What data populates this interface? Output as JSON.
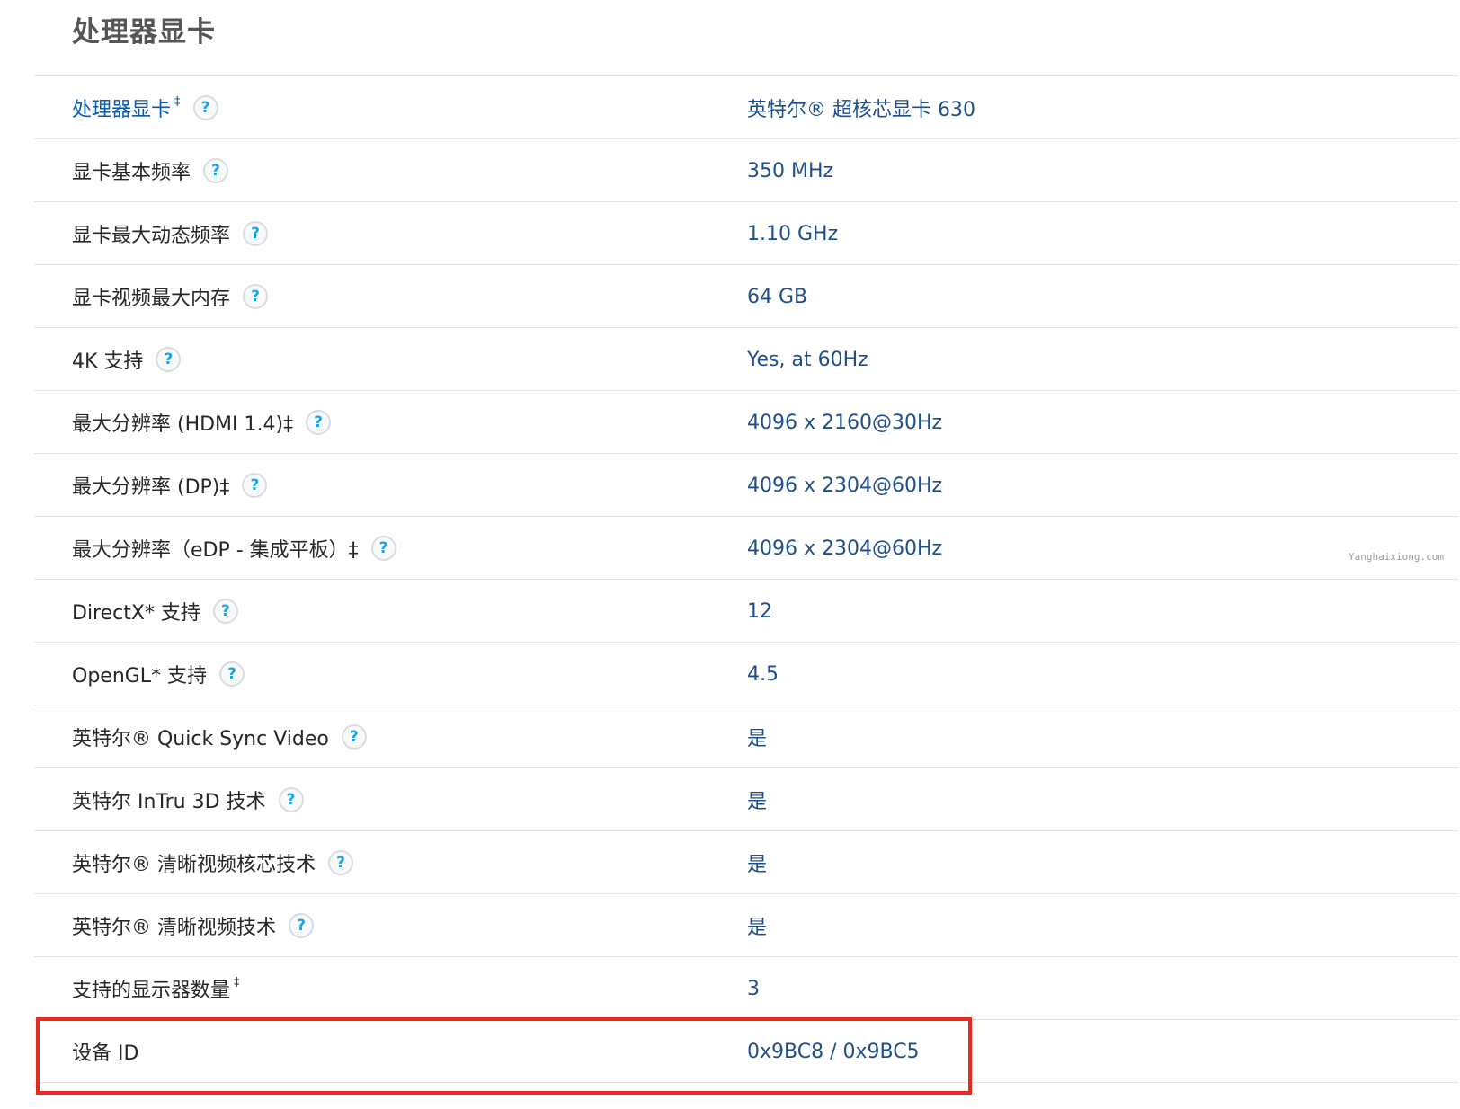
{
  "section": {
    "title": "处理器显卡"
  },
  "watermark": "Yanghaixiong.com",
  "colors": {
    "label": "#262626",
    "link": "#0b5cad",
    "value": "#1f4f8b",
    "help_icon": "#1aa3e8",
    "divider": "#e4e4e4",
    "highlight": "#e8291c"
  },
  "rows": [
    {
      "label": "处理器显卡",
      "dagger": "‡",
      "help": "?",
      "value": "英特尔® 超核芯显卡 630"
    },
    {
      "label": "显卡基本频率",
      "help": "?",
      "value": "350 MHz"
    },
    {
      "label": "显卡最大动态频率",
      "help": "?",
      "value": "1.10 GHz"
    },
    {
      "label": "显卡视频最大内存",
      "help": "?",
      "value": "64 GB"
    },
    {
      "label": "4K 支持",
      "help": "?",
      "value": "Yes, at 60Hz"
    },
    {
      "label": "最大分辨率 (HDMI 1.4)‡",
      "help": "?",
      "value": "4096 x 2160@30Hz"
    },
    {
      "label": "最大分辨率 (DP)‡",
      "help": "?",
      "value": "4096 x 2304@60Hz"
    },
    {
      "label": "最大分辨率（eDP - 集成平板）‡",
      "help": "?",
      "value": "4096 x 2304@60Hz"
    },
    {
      "label": "DirectX* 支持",
      "help": "?",
      "value": "12"
    },
    {
      "label": "OpenGL* 支持",
      "help": "?",
      "value": "4.5"
    },
    {
      "label": "英特尔® Quick Sync Video",
      "help": "?",
      "value": "是"
    },
    {
      "label": "英特尔 InTru 3D 技术",
      "help": "?",
      "value": "是"
    },
    {
      "label": "英特尔® 清晰视频核芯技术",
      "help": "?",
      "value": "是"
    },
    {
      "label": "英特尔® 清晰视频技术",
      "help": "?",
      "value": "是"
    },
    {
      "label": "支持的显示器数量",
      "dagger": "‡",
      "value": "3"
    },
    {
      "label": "设备 ID",
      "value": "0x9BC8 / 0x9BC5"
    }
  ]
}
